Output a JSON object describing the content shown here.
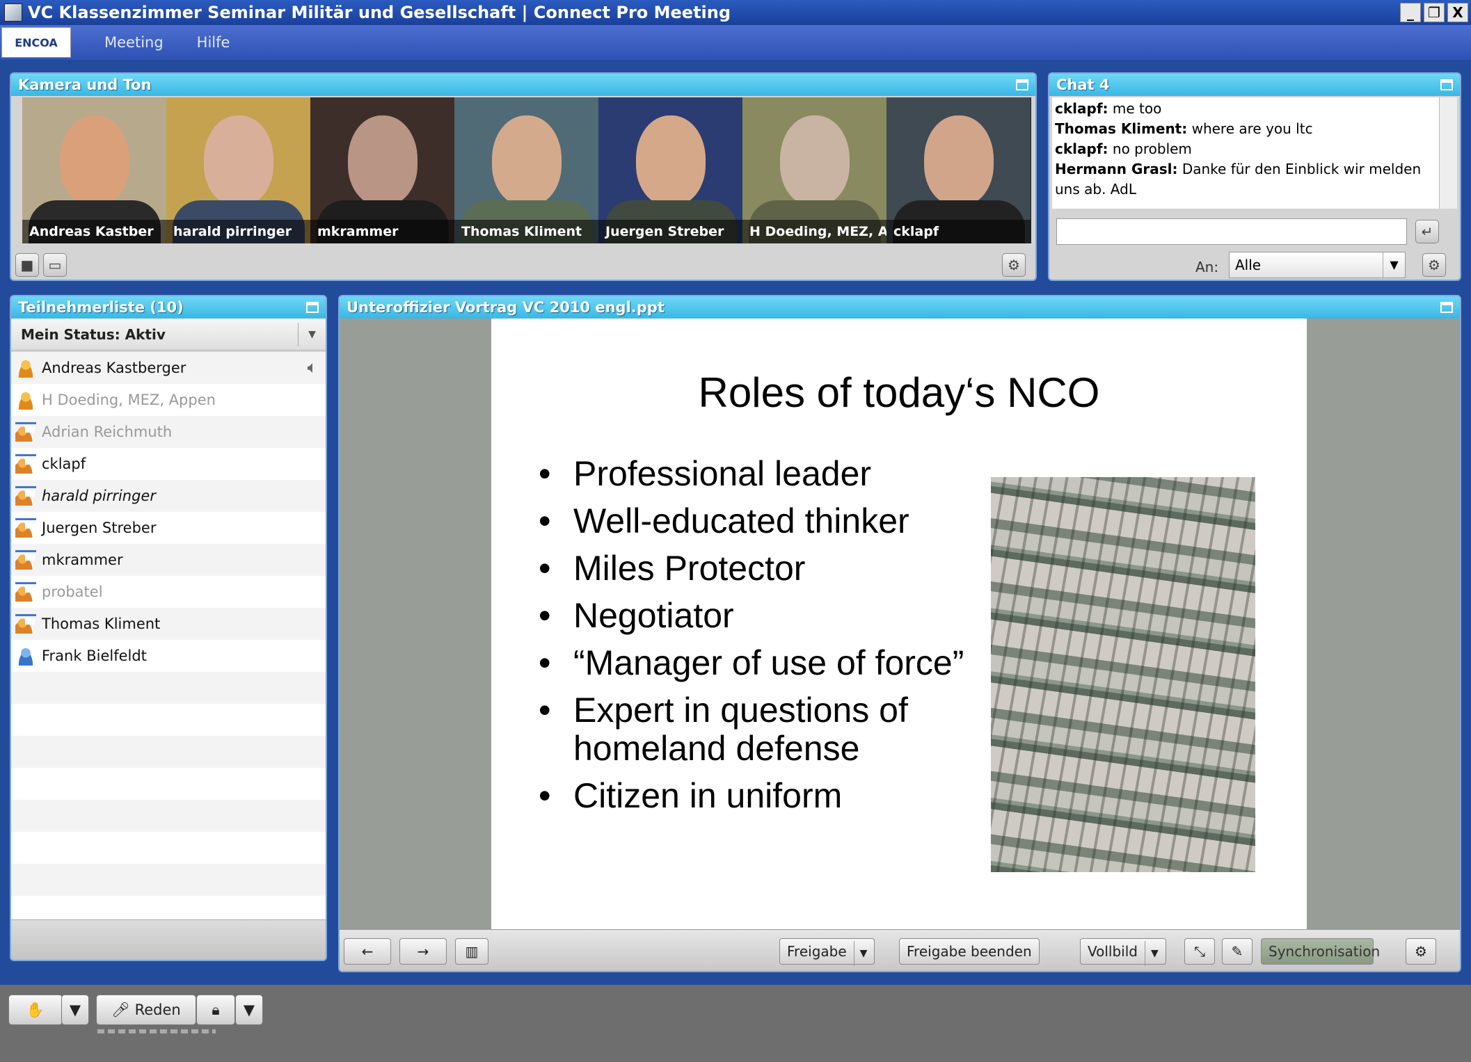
{
  "window": {
    "title": "VC Klassenzimmer Seminar Militär und Gesellschaft | Connect Pro Meeting",
    "minimize": "_",
    "restore": "❐",
    "close": "X"
  },
  "menubar": {
    "logo": "ENCOA",
    "items": [
      "Meeting",
      "Hilfe"
    ]
  },
  "camera_pod": {
    "title": "Kamera und Ton",
    "videos": [
      {
        "name": "Andreas Kastber",
        "skin": "#d9a07a",
        "bg": "#b7a98c",
        "shirt": "#2a2a2a"
      },
      {
        "name": "harald pirringer",
        "skin": "#d8b09a",
        "bg": "#c4a24f",
        "shirt": "#3b4b66"
      },
      {
        "name": "mkrammer",
        "skin": "#b89584",
        "bg": "#3d2e2a",
        "shirt": "#1e1e1e"
      },
      {
        "name": "Thomas Kliment",
        "skin": "#d4aa8c",
        "bg": "#506a76",
        "shirt": "#5c6d55"
      },
      {
        "name": "Juergen Streber",
        "skin": "#d6a88a",
        "bg": "#2b3c72",
        "shirt": "#414a3e"
      },
      {
        "name": "H Doeding, MEZ, Ap",
        "skin": "#c9b4a4",
        "bg": "#8a8a60",
        "shirt": "#5f6449"
      },
      {
        "name": "cklapf",
        "skin": "#d0a589",
        "bg": "#3f4a52",
        "shirt": "#222"
      }
    ]
  },
  "chat_pod": {
    "title": "Chat 4",
    "messages": [
      {
        "from": "cklapf:",
        "text": " me too"
      },
      {
        "from": "Thomas Kliment:",
        "text": " where are you ltc"
      },
      {
        "from": "cklapf:",
        "text": " no problem"
      },
      {
        "from": "Hermann Grasl:",
        "text": " Danke für den Einblick wir melden uns ab. AdL"
      }
    ],
    "input_value": "",
    "to_label": "An:",
    "to_value": "Alle"
  },
  "attendee_pod": {
    "title": "Teilnehmerliste (10)",
    "my_status": "Mein Status: Aktiv",
    "attendees": [
      {
        "name": "Andreas Kastberger",
        "role": "host",
        "inactive": false
      },
      {
        "name": "H Doeding, MEZ, Appen",
        "role": "host",
        "inactive": true
      },
      {
        "name": "Adrian Reichmuth",
        "role": "presenter",
        "inactive": true
      },
      {
        "name": "cklapf",
        "role": "presenter",
        "inactive": false
      },
      {
        "name": "harald pirringer",
        "role": "presenter",
        "inactive": false
      },
      {
        "name": "Juergen Streber",
        "role": "presenter",
        "inactive": false
      },
      {
        "name": "mkrammer",
        "role": "presenter",
        "inactive": false
      },
      {
        "name": "probatel",
        "role": "presenter",
        "inactive": true
      },
      {
        "name": "Thomas Kliment",
        "role": "presenter",
        "inactive": false
      },
      {
        "name": "Frank Bielfeldt",
        "role": "participant",
        "inactive": false
      }
    ]
  },
  "share_pod": {
    "title": "Unteroffizier Vortrag VC 2010 engl.ppt",
    "slide": {
      "title": "Roles of today‘s NCO",
      "bullets": [
        "Professional leader",
        "Well-educated thinker",
        "Miles Protector",
        "Negotiator",
        "“Manager of use of force”",
        "Expert in questions of homeland defense",
        "Citizen in uniform"
      ]
    },
    "toolbar": {
      "prev": "←",
      "next": "→",
      "share": "Freigabe",
      "stop_share": "Freigabe beenden",
      "fullscreen": "Vollbild",
      "sync": "Synchronisation"
    }
  },
  "bottombar": {
    "speak": "Reden"
  }
}
